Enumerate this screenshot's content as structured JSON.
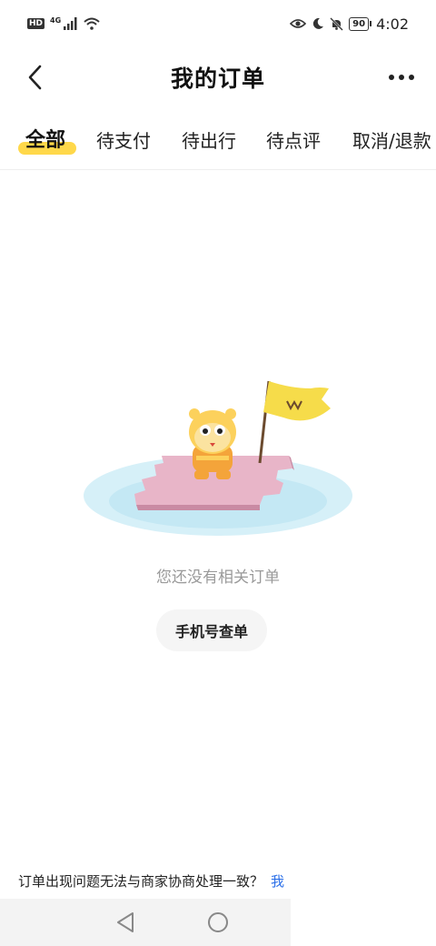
{
  "status_bar": {
    "hd": "HD",
    "network": "4G",
    "battery": "90",
    "time": "4:02"
  },
  "header": {
    "title": "我的订单",
    "back_icon": "chevron-left-icon",
    "more_icon": "more-dots-icon"
  },
  "tabs": [
    {
      "label": "全部",
      "active": true
    },
    {
      "label": "待支付",
      "active": false
    },
    {
      "label": "待出行",
      "active": false
    },
    {
      "label": "待点评",
      "active": false
    },
    {
      "label": "取消/退款",
      "active": false
    }
  ],
  "empty_state": {
    "message": "您还没有相关订单",
    "button_label": "手机号查单",
    "illustration": "mascot-on-raft-with-flag"
  },
  "help": {
    "text": "订单出现问题无法与商家协商处理一致？",
    "link": "我"
  },
  "colors": {
    "accent": "#ffd84a",
    "link": "#2b6fe8",
    "muted_text": "#9a9a9a"
  }
}
